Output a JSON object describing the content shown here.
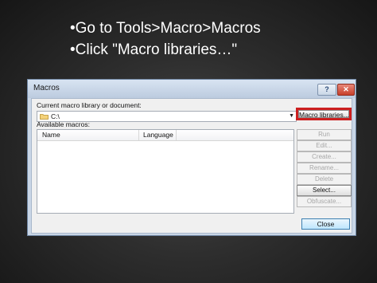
{
  "slide": {
    "bullets": [
      "•Go to Tools>Macro>Macros",
      "•Click \"Macro libraries…\""
    ]
  },
  "dialog": {
    "title": "Macros",
    "help_label": "?",
    "close_label": "✕",
    "library_label": "Current macro library or document:",
    "library_value": "C:\\",
    "library_dropdown_arrow": "▼",
    "macro_libraries_button": "Macro libraries...",
    "available_label": "Available macros:",
    "columns": [
      "Name",
      "Language"
    ],
    "rows": [],
    "buttons": [
      {
        "label": "Run",
        "enabled": false
      },
      {
        "label": "Edit...",
        "enabled": false
      },
      {
        "label": "Create...",
        "enabled": false
      },
      {
        "label": "Rename...",
        "enabled": false
      },
      {
        "label": "Delete",
        "enabled": false
      },
      {
        "label": "Select...",
        "enabled": true
      },
      {
        "label": "Obfuscate...",
        "enabled": false
      }
    ],
    "close_button": "Close"
  },
  "colors": {
    "highlight_border": "#cc1f1f",
    "dialog_frame": "#c9d6e6",
    "title_close": "#c8402b"
  },
  "icons": {
    "folder": "folder-icon",
    "dropdown": "chevron-down-icon"
  }
}
